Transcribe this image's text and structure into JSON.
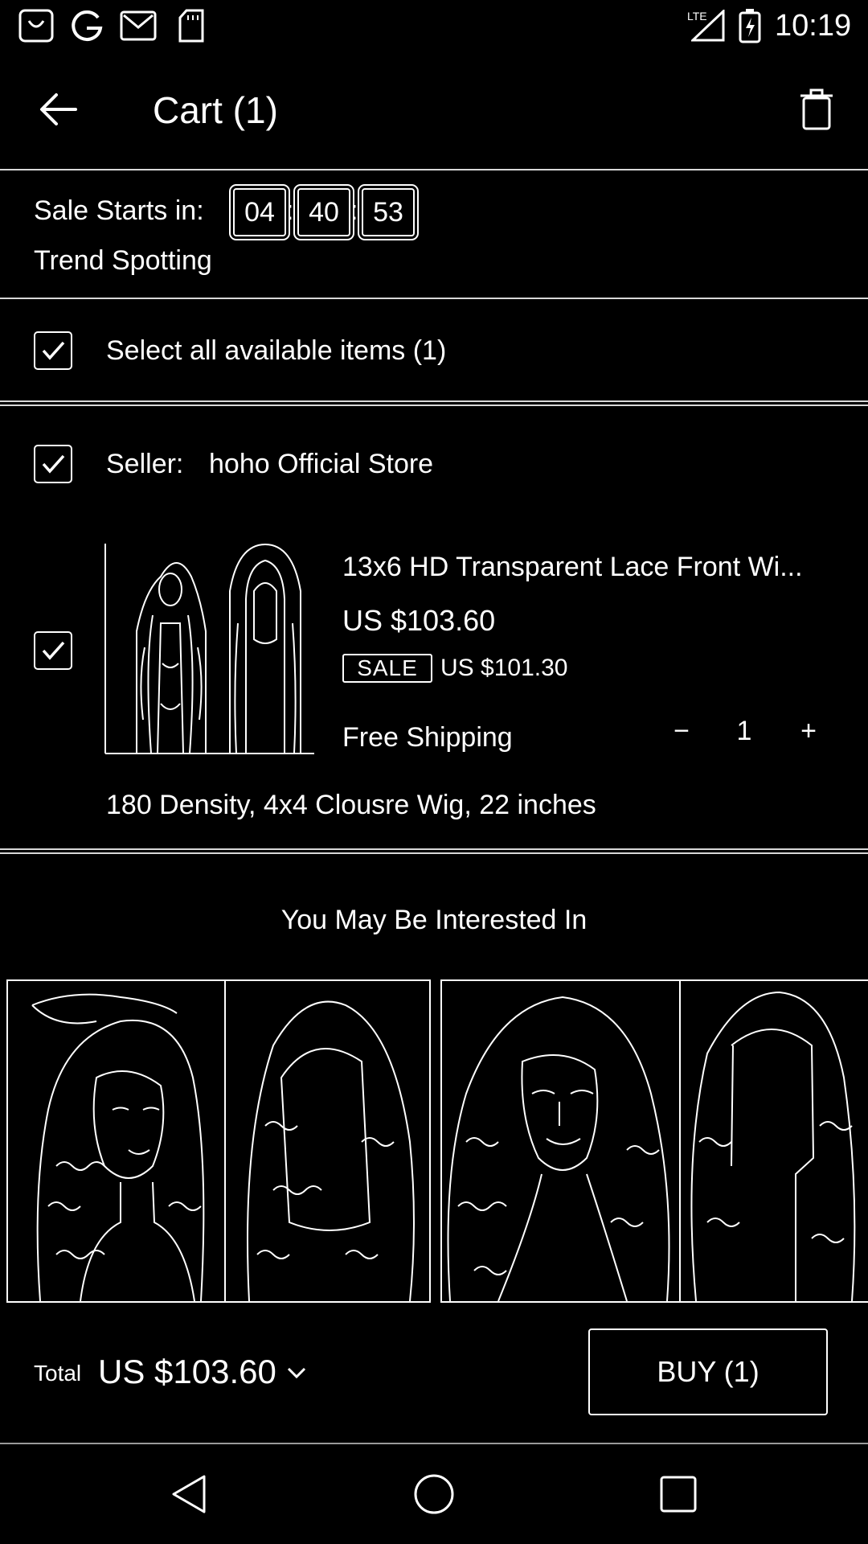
{
  "status_bar": {
    "time": "10:19",
    "network": "LTE",
    "icons": [
      "shopping-bag-icon",
      "google-icon",
      "gmail-icon",
      "sd-card-icon",
      "signal-icon",
      "battery-charging-icon"
    ]
  },
  "header": {
    "title": "Cart (1)",
    "back_icon": "back-arrow-icon",
    "delete_icon": "trash-icon"
  },
  "sale": {
    "label": "Sale Starts in:",
    "hours": "04",
    "minutes": "40",
    "seconds": "53",
    "separator": ":",
    "subtitle": "Trend Spotting"
  },
  "select_all": {
    "label": "Select all available items (1)",
    "checked": true
  },
  "seller": {
    "prefix": "Seller:",
    "name": "hoho Official Store",
    "checked": true
  },
  "product": {
    "title": "13x6 HD Transparent Lace Front Wi...",
    "price": "US $103.60",
    "sale_badge": "SALE",
    "sale_price": "US $101.30",
    "shipping": "Free Shipping",
    "quantity": "1",
    "minus": "−",
    "plus": "+",
    "variant": "180 Density, 4x4 Clousre Wig, 22 inches",
    "checked": true
  },
  "recommendations": {
    "title": "You May Be Interested In"
  },
  "bottom_bar": {
    "total_label": "Total",
    "total_value": "US $103.60",
    "buy_label": "BUY (1)"
  },
  "nav_bar": {
    "icons": [
      "nav-back-icon",
      "nav-home-icon",
      "nav-recents-icon"
    ]
  },
  "colors": {
    "background": "#000000",
    "foreground": "#ffffff",
    "divider": "#d8d8d8"
  }
}
